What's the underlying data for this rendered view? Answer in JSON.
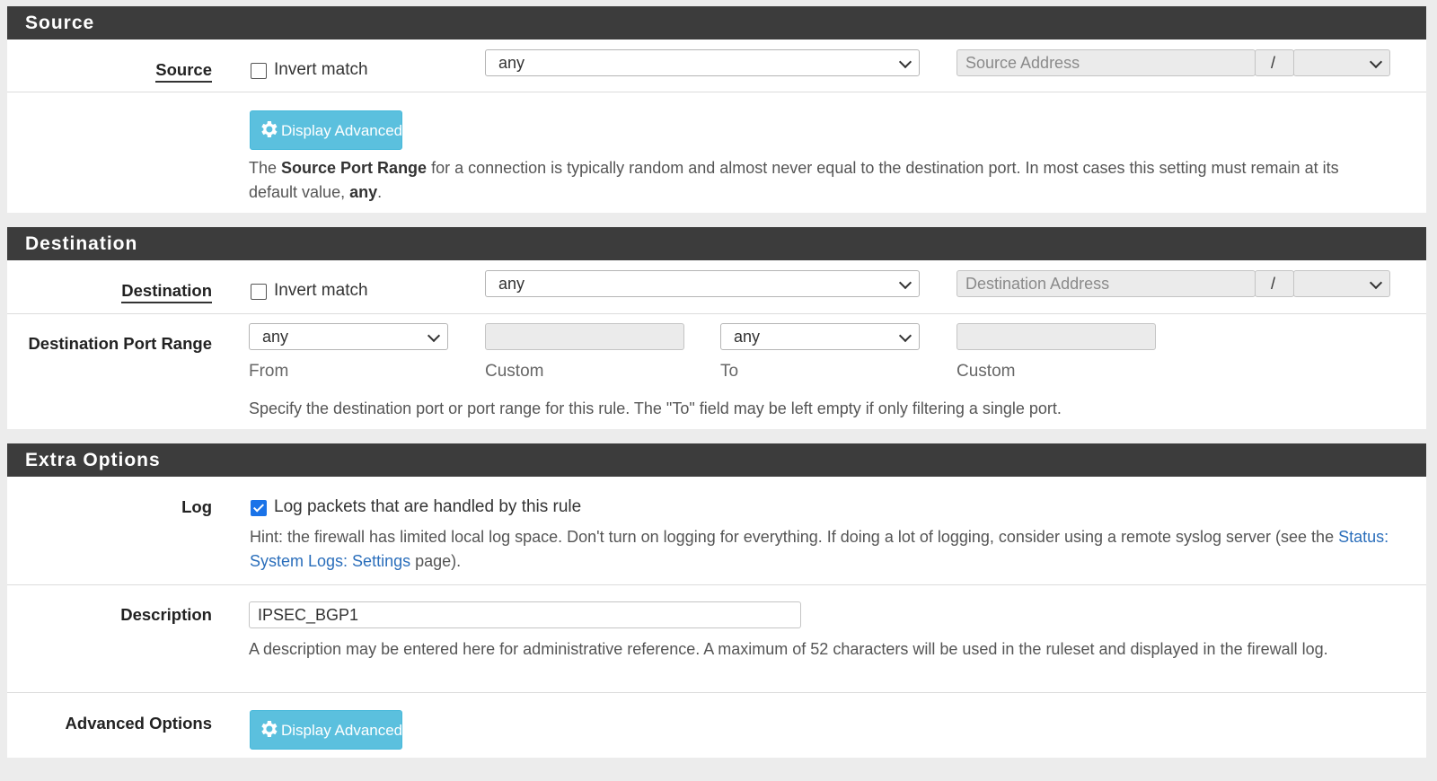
{
  "source": {
    "heading": "Source",
    "label": "Source",
    "invert_label": "Invert match",
    "type_value": "any",
    "address_placeholder": "Source Address",
    "slash": "/",
    "advanced_button": "Display Advanced",
    "help": {
      "p1": "The ",
      "strong1": "Source Port Range",
      "p2": " for a connection is typically random and almost never equal to the destination port. In most cases this setting must remain at its default value, ",
      "strong2": "any",
      "p3": "."
    }
  },
  "destination": {
    "heading": "Destination",
    "label": "Destination",
    "invert_label": "Invert match",
    "type_value": "any",
    "address_placeholder": "Destination Address",
    "slash": "/",
    "port_range_label": "Destination Port Range",
    "from_value": "any",
    "to_value": "any",
    "from_caption": "From",
    "custom_caption_1": "Custom",
    "to_caption": "To",
    "custom_caption_2": "Custom",
    "help": "Specify the destination port or port range for this rule. The \"To\" field may be left empty if only filtering a single port."
  },
  "extra": {
    "heading": "Extra Options",
    "log_label": "Log",
    "log_checked": true,
    "log_text": "Log packets that are handled by this rule",
    "log_hint_1": "Hint: the firewall has limited local log space. Don't turn on logging for everything. If doing a lot of logging, consider using a remote syslog server (see the ",
    "log_hint_link": "Status: System Logs: Settings",
    "log_hint_2": " page).",
    "description_label": "Description",
    "description_value": "IPSEC_BGP1",
    "description_help": "A description may be entered here for administrative reference. A maximum of 52 characters will be used in the ruleset and displayed in the firewall log.",
    "advanced_label": "Advanced Options",
    "advanced_button": "Display Advanced"
  },
  "colors": {
    "heading_bg": "#3c3c3c",
    "button_info": "#5bc0de",
    "checkbox_checked": "#1a73e8",
    "link": "#2a6ebb"
  }
}
